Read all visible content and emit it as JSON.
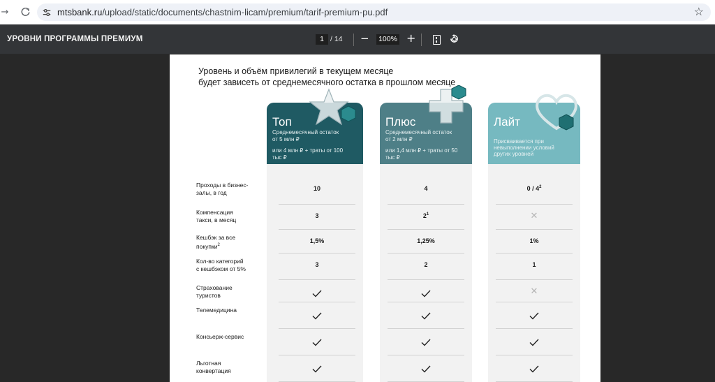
{
  "browser": {
    "url_host": "mtsbank.ru",
    "url_path": "/upload/static/documents/chastnim-licam/premium/tarif-premium-pu.pdf"
  },
  "pdf_toolbar": {
    "title": "УРОВНИ ПРОГРАММЫ ПРЕМИУМ",
    "page_current": "1",
    "page_total": "/ 14",
    "zoom": "100%"
  },
  "document": {
    "intro_line1": "Уровень и объём привилегий в текущем месяце",
    "intro_line2": "будет зависеть от среднемесячного остатка в прошлом месяце",
    "tiers": [
      {
        "name": "Топ",
        "color": "#1f5a63",
        "sub1": "Среднемесячный остаток",
        "sub2": "от 5 млн ₽",
        "sub3": "или 4 млн ₽ + траты от 100",
        "sub4": "тыс ₽"
      },
      {
        "name": "Плюс",
        "color": "#4e7f87",
        "sub1": "Среднемесячный остаток",
        "sub2": "от 2 млн ₽",
        "sub3": "или 1,4 млн ₽ + траты от 50",
        "sub4": "тыс ₽"
      },
      {
        "name": "Лайт",
        "color": "#76b9c0",
        "sub1": "Присваивается при",
        "sub2": "невыполнении условий",
        "sub3": "других уровней"
      }
    ],
    "rows": [
      {
        "label1": "Проходы в бизнес-",
        "label2": "залы, в год",
        "top": "10",
        "plus": "4",
        "lite": "0 / 4",
        "lite_sup": "2"
      },
      {
        "label1": "Компенсация",
        "label2": "такси, в месяц",
        "top": "3",
        "plus": "2",
        "plus_sup": "1",
        "lite": "cross"
      },
      {
        "label1": "Кешбэк за все",
        "label2": "покупки",
        "label2_sup": "2",
        "top": "1,5%",
        "plus": "1,25%",
        "lite": "1%"
      },
      {
        "label1": "Кол-во категорий",
        "label2": "с кешбэком от 5%",
        "top": "3",
        "plus": "2",
        "lite": "1"
      },
      {
        "label1": "Страхование",
        "label2": "туристов",
        "top": "check",
        "plus": "check",
        "lite": "cross"
      },
      {
        "label1": "Телемедицина",
        "top": "check",
        "plus": "check",
        "lite": "check"
      },
      {
        "label1": "Консьерж-сервис",
        "top": "check",
        "plus": "check",
        "lite": "check"
      },
      {
        "label1": "Льготная",
        "label2": "конвертация",
        "top": "check",
        "plus": "check",
        "lite": "check"
      }
    ]
  }
}
